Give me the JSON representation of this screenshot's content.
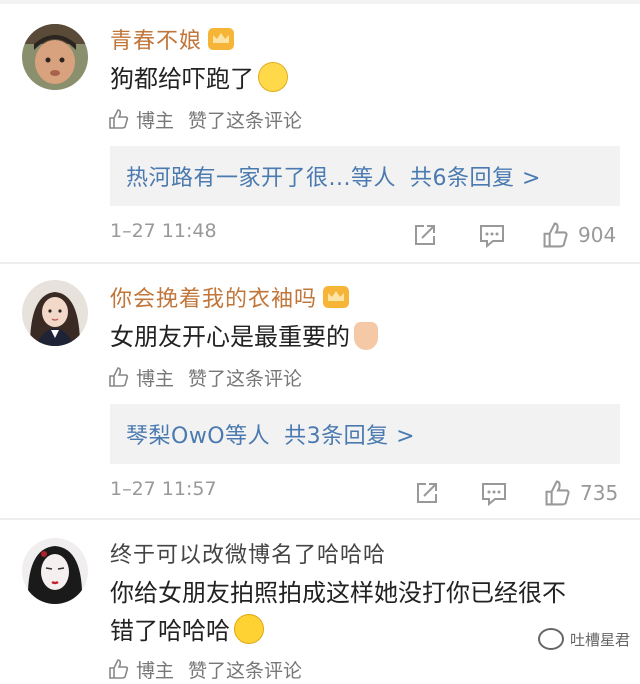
{
  "comments": [
    {
      "username": "青春不娘",
      "vip": true,
      "text": "狗都给吓跑了",
      "emoji": "sleepy-face-emoji",
      "blogger_label": "博主",
      "liked_text": "赞了这条评论",
      "reply_preview": "热河路有一家开了很...等人",
      "reply_total": "共6条回复 >",
      "time": "1–27 11:48",
      "like_count": "904"
    },
    {
      "username": "你会挽着我的衣袖吗",
      "vip": true,
      "text": "女朋友开心是最重要的",
      "emoji": "thumbs-up-emoji",
      "blogger_label": "博主",
      "liked_text": "赞了这条评论",
      "reply_preview": "琴梨OwO等人",
      "reply_total": "共3条回复 >",
      "time": "1–27 11:57",
      "like_count": "735"
    },
    {
      "username": "终于可以改微博名了哈哈哈",
      "vip": false,
      "text_line1": "你给女朋友拍照拍成这样她没打你已经很不",
      "text_line2": "错了哈哈哈",
      "emoji": "laughing-tears-emoji",
      "blogger_label": "博主",
      "liked_text": "赞了这条评论"
    }
  ],
  "watermark": "吐槽星君",
  "colors": {
    "username": "#c1763a",
    "reply_link": "#4a7ab0",
    "meta": "#999999",
    "reply_bg": "#f2f2f2"
  }
}
